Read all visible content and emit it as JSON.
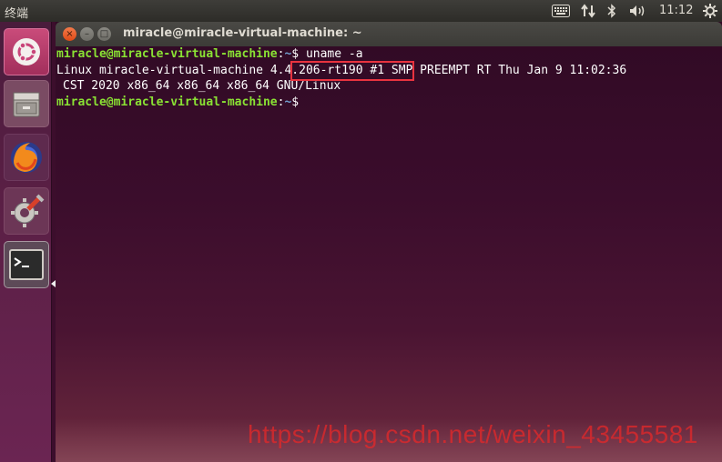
{
  "top_panel": {
    "app_title": "终端",
    "clock": "11:12",
    "indicators": [
      "keyboard-icon",
      "network-icon",
      "bluetooth-icon",
      "volume-icon",
      "gear-icon"
    ]
  },
  "launcher": {
    "items": [
      "ubuntu-dash-icon",
      "files-icon",
      "firefox-icon",
      "settings-icon",
      "terminal-icon"
    ]
  },
  "window": {
    "title": "miracle@miracle-virtual-machine: ~",
    "buttons": {
      "close": "×",
      "minimize": "–",
      "maximize": "□"
    }
  },
  "terminal": {
    "prompt_user": "miracle@miracle-virtual-machine",
    "prompt_sep": ":",
    "prompt_path": "~",
    "prompt_symbol": "$",
    "command": " uname -a",
    "output_line1_pre": "Linux miracle-virtual-machine ",
    "output_line1_version": "4.4.206-rt190",
    "output_line1_post": " #1 SMP PREEMPT RT Thu Jan 9 11:02:36",
    "output_line2": "CST 2020 x86_64 x86_64 x86_64 GNU/Linux"
  },
  "watermark": "https://blog.csdn.net/weixin_43455581",
  "colors": {
    "prompt_user": "#8ae234",
    "prompt_path": "#729fcf",
    "highlight": "#e8333f",
    "terminal_bg": "#300a24"
  }
}
